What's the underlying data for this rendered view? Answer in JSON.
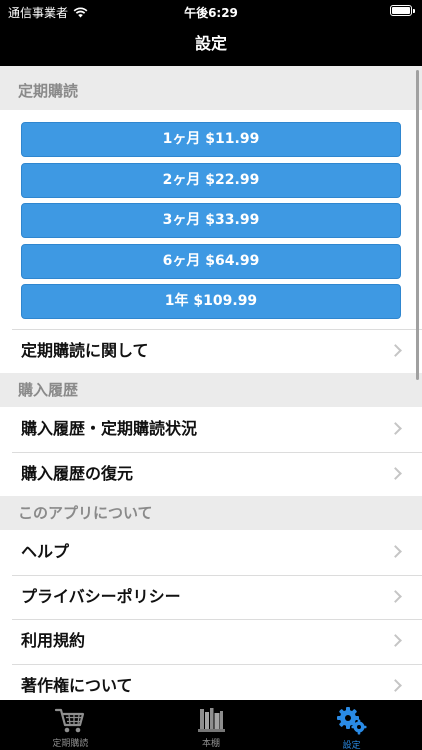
{
  "status_bar": {
    "carrier": "通信事業者",
    "time": "午後6:29"
  },
  "nav": {
    "title": "設定"
  },
  "sections": {
    "subscription": {
      "header": "定期購読",
      "plans": [
        "1ヶ月 $11.99",
        "2ヶ月 $22.99",
        "3ヶ月 $33.99",
        "6ヶ月 $64.99",
        "1年 $109.99"
      ],
      "about": "定期購読に関して"
    },
    "purchase": {
      "header": "購入履歴",
      "items": [
        "購入履歴・定期購読状況",
        "購入履歴の復元"
      ]
    },
    "app": {
      "header": "このアプリについて",
      "items": [
        "ヘルプ",
        "プライバシーポリシー",
        "利用規約",
        "著作権について"
      ]
    }
  },
  "tabs": {
    "items": [
      {
        "label": "定期購読",
        "icon": "cart-icon"
      },
      {
        "label": "本棚",
        "icon": "bookshelf-icon"
      },
      {
        "label": "設定",
        "icon": "gear-icon"
      }
    ],
    "active_color": "#2a8be6",
    "inactive_color": "#8e8e8e"
  },
  "colors": {
    "plan_button": "#3e99e3",
    "section_header_bg": "#ebebeb"
  }
}
